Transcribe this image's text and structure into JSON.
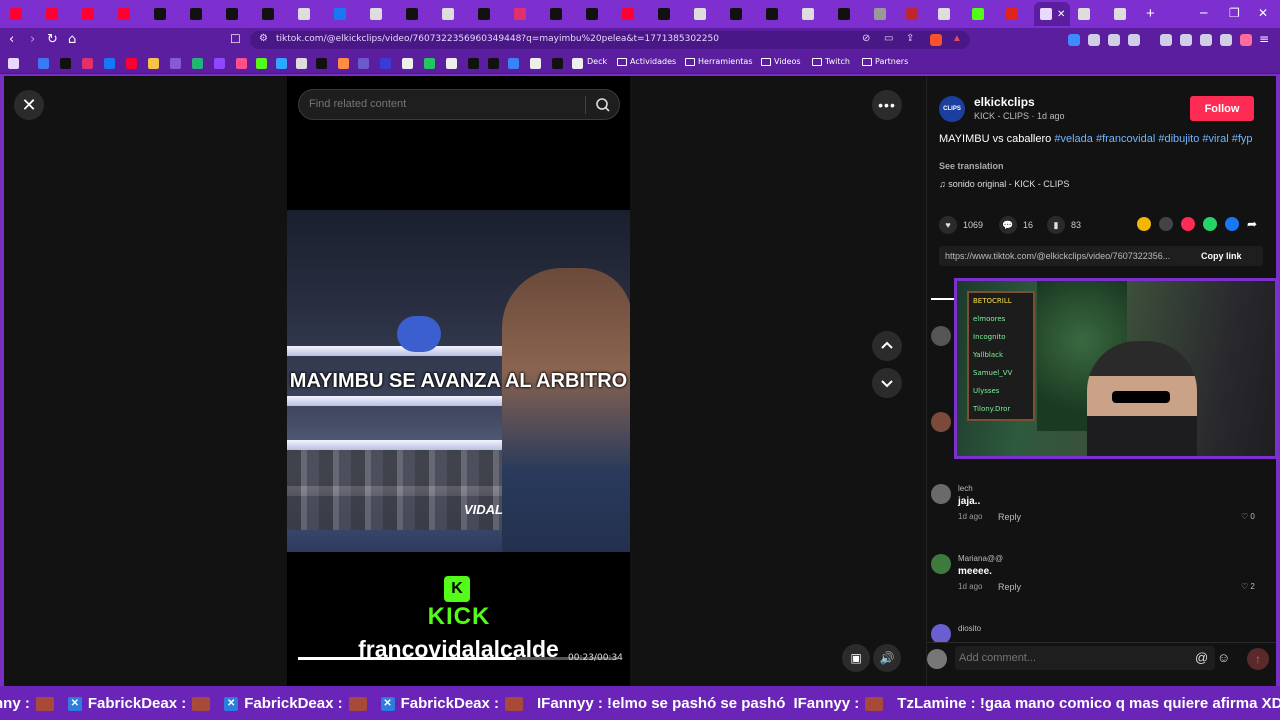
{
  "browser": {
    "url": "tiktok.com/@elkickclips/video/7607322356960349448?q=mayimbu%20pelea&t=1771385302250",
    "bookmarks": [
      {
        "label": "Deck"
      },
      {
        "label": "Actividades"
      },
      {
        "label": "Herramientas"
      },
      {
        "label": "Videos"
      },
      {
        "label": "Twitch"
      },
      {
        "label": "Partners"
      }
    ],
    "accent": "#7d2fd0"
  },
  "search": {
    "placeholder": "Find related content"
  },
  "video": {
    "caption": "MAYIMBU SE AVANZA AL ARBITRO",
    "badge": "VIDAL",
    "kick_text": "KICK",
    "channel_overlay": "francovidalalcalde",
    "timecode": "00:23/00:34",
    "progress": 0.68
  },
  "post": {
    "author": "elkickclips",
    "author_sub": "KICK - CLIPS",
    "posted": "1d ago",
    "follow_label": "Follow",
    "description": "MAYIMBU vs caballero",
    "hashtags": [
      "#velada",
      "#francovidal",
      "#dibujito",
      "#viral",
      "#fyp"
    ],
    "see_translation": "See translation",
    "sound": "sonido original - KICK - CLIPS",
    "likes": "1069",
    "comments": "16",
    "saves": "83",
    "link": "https://www.tiktok.com/@elkickclips/video/7607322356...",
    "copy_link": "Copy link"
  },
  "comments": [
    {
      "user": "lech",
      "text": "jaja..",
      "time": "1d ago",
      "reply": "Reply",
      "likes": "0"
    },
    {
      "user": "Mariana@@",
      "text": "meeee.",
      "time": "1d ago",
      "reply": "Reply",
      "likes": "2"
    },
    {
      "user": "diosito",
      "text": "",
      "time": "",
      "reply": "",
      "likes": ""
    }
  ],
  "comment_box": {
    "placeholder": "Add comment..."
  },
  "webcam": {
    "board_lines": [
      "BETOCRILL",
      "elmoores",
      "Incognito",
      "Yallblack",
      "Samuel_VV",
      "Ulysses",
      "Tilony.Dror"
    ]
  },
  "ticker": {
    "messages": [
      {
        "user": "nny",
        "text": ""
      },
      {
        "user": "FabrickDeax",
        "text": ""
      },
      {
        "user": "FabrickDeax",
        "text": ""
      },
      {
        "user": "FabrickDeax",
        "text": ""
      },
      {
        "user": "IFannyy",
        "text": "!elmo se pashó se pashó"
      },
      {
        "user": "IFannyy",
        "text": ""
      },
      {
        "user": "TzLamine",
        "text": "!gaa mano comico q mas quiere afirma XDD"
      }
    ]
  }
}
